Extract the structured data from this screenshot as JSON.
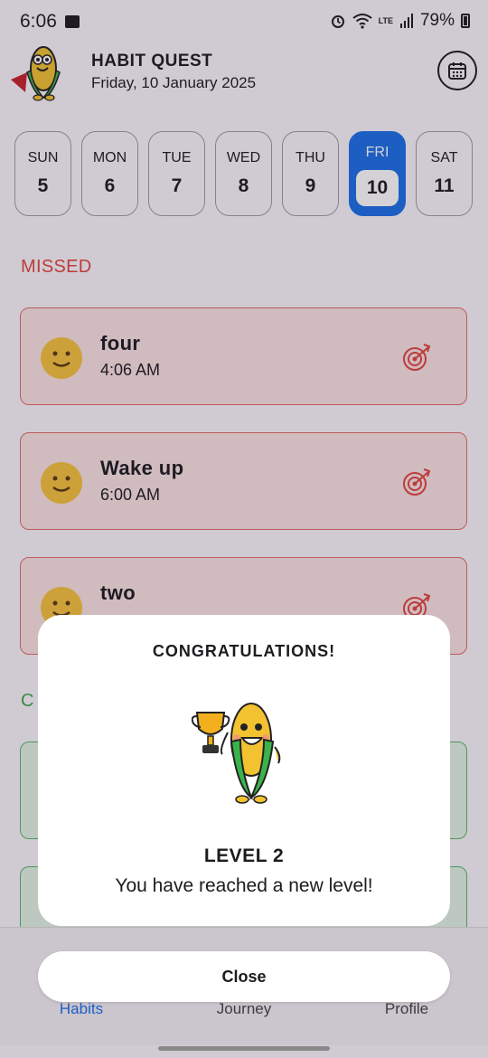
{
  "status_bar": {
    "time": "6:06",
    "battery": "79%",
    "net_label": "LTE"
  },
  "header": {
    "title": "HABIT QUEST",
    "date": "Friday, 10 January 2025"
  },
  "week": [
    {
      "day": "SUN",
      "date": "5"
    },
    {
      "day": "MON",
      "date": "6"
    },
    {
      "day": "TUE",
      "date": "7"
    },
    {
      "day": "WED",
      "date": "8"
    },
    {
      "day": "THU",
      "date": "9"
    },
    {
      "day": "FRI",
      "date": "10",
      "selected": true
    },
    {
      "day": "SAT",
      "date": "11"
    }
  ],
  "sections": {
    "missed": "MISSED",
    "completed_partial": "C"
  },
  "missed_habits": [
    {
      "name": "four",
      "time": "4:06 AM"
    },
    {
      "name": "Wake up",
      "time": "6:00 AM"
    },
    {
      "name": "two",
      "time": ""
    }
  ],
  "nav": {
    "habits": "Habits",
    "journey": "Journey",
    "profile": "Profile"
  },
  "dialog": {
    "title": "CONGRATULATIONS!",
    "level": "LEVEL 2",
    "message": "You have reached a new level!",
    "close": "Close"
  },
  "colors": {
    "accent": "#1b6fe8",
    "missed": "#e2453c",
    "completed": "#3aa648"
  },
  "icons": [
    "image-icon",
    "alarm-icon",
    "wifi-icon",
    "signal-icon",
    "battery-icon",
    "calendar-icon",
    "target-icon",
    "smiley-icon",
    "trophy-icon"
  ]
}
